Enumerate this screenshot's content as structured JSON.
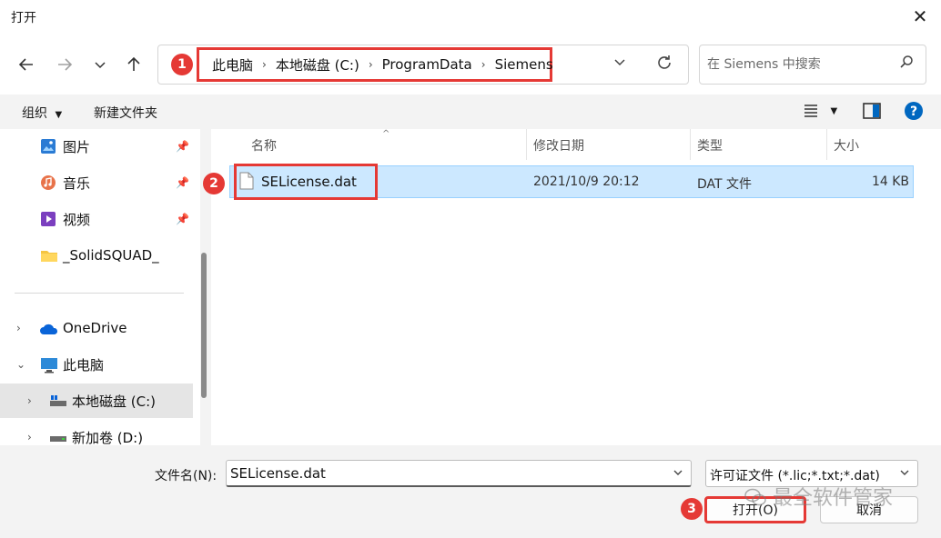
{
  "window": {
    "title": "打开"
  },
  "address": {
    "crumbs": [
      "此电脑",
      "本地磁盘 (C:)",
      "ProgramData",
      "Siemens"
    ]
  },
  "search": {
    "placeholder": "在 Siemens 中搜索"
  },
  "toolbar": {
    "organize": "组织",
    "new_folder": "新建文件夹"
  },
  "nav": {
    "items": [
      {
        "label": "图片",
        "icon": "pictures-icon",
        "pinned": true
      },
      {
        "label": "音乐",
        "icon": "music-icon",
        "pinned": true
      },
      {
        "label": "视频",
        "icon": "videos-icon",
        "pinned": true
      },
      {
        "label": "_SolidSQUAD_",
        "icon": "folder-icon",
        "pinned": false
      },
      {
        "label": "OneDrive",
        "icon": "onedrive-icon"
      },
      {
        "label": "此电脑",
        "icon": "this-pc-icon"
      },
      {
        "label": "本地磁盘 (C:)",
        "icon": "drive-icon",
        "selected": true
      },
      {
        "label": "新加卷 (D:)",
        "icon": "drive-icon"
      }
    ]
  },
  "columns": {
    "name": "名称",
    "modified": "修改日期",
    "type": "类型",
    "size": "大小"
  },
  "files": [
    {
      "name": "SELicense.dat",
      "modified": "2021/10/9 20:12",
      "type": "DAT 文件",
      "size": "14 KB"
    }
  ],
  "bottom": {
    "filename_label": "文件名(N):",
    "filename_value": "SELicense.dat",
    "filter": "许可证文件 (*.lic;*.txt;*.dat)",
    "open": "打开(O)",
    "cancel": "取消"
  },
  "annotations": [
    "1",
    "2",
    "3"
  ],
  "watermark": "最全软件管家",
  "colors": {
    "highlight": "#e53935",
    "selection": "#cce8ff",
    "help": "#0067c0"
  }
}
